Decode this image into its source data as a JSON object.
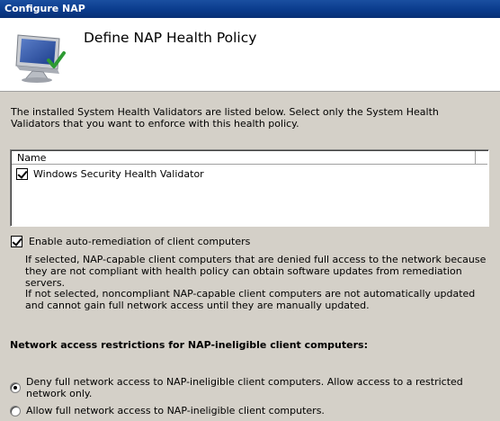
{
  "window": {
    "title": "Configure NAP"
  },
  "header": {
    "title": "Define NAP Health Policy",
    "icon": "monitor-with-checkmark-icon"
  },
  "intro_text": "The installed System Health Validators are listed below. Select only the System Health Validators that you want to enforce with this health policy.",
  "validators": {
    "column_name": "Name",
    "items": [
      {
        "label": "Windows Security Health Validator",
        "checked": true
      }
    ]
  },
  "auto_remediation": {
    "label": "Enable auto-remediation of client computers",
    "checked": true,
    "help_selected": "If selected, NAP-capable client computers that are denied full access to the network because they are not compliant with health policy can obtain software updates from remediation servers.",
    "help_not_selected": "If not selected, noncompliant NAP-capable client computers are not automatically updated and cannot gain full network access until they are manually updated."
  },
  "restrictions": {
    "heading": "Network access restrictions for NAP-ineligible client computers:",
    "options": [
      {
        "label": "Deny full network access to NAP-ineligible client computers. Allow access to a restricted network only.",
        "selected": true
      },
      {
        "label": "Allow full network access to NAP-ineligible client computers.",
        "selected": false
      }
    ]
  },
  "colors": {
    "title_bar": "#0a3b8c",
    "dialog_background": "#d4d0c8",
    "header_background": "#ffffff"
  }
}
